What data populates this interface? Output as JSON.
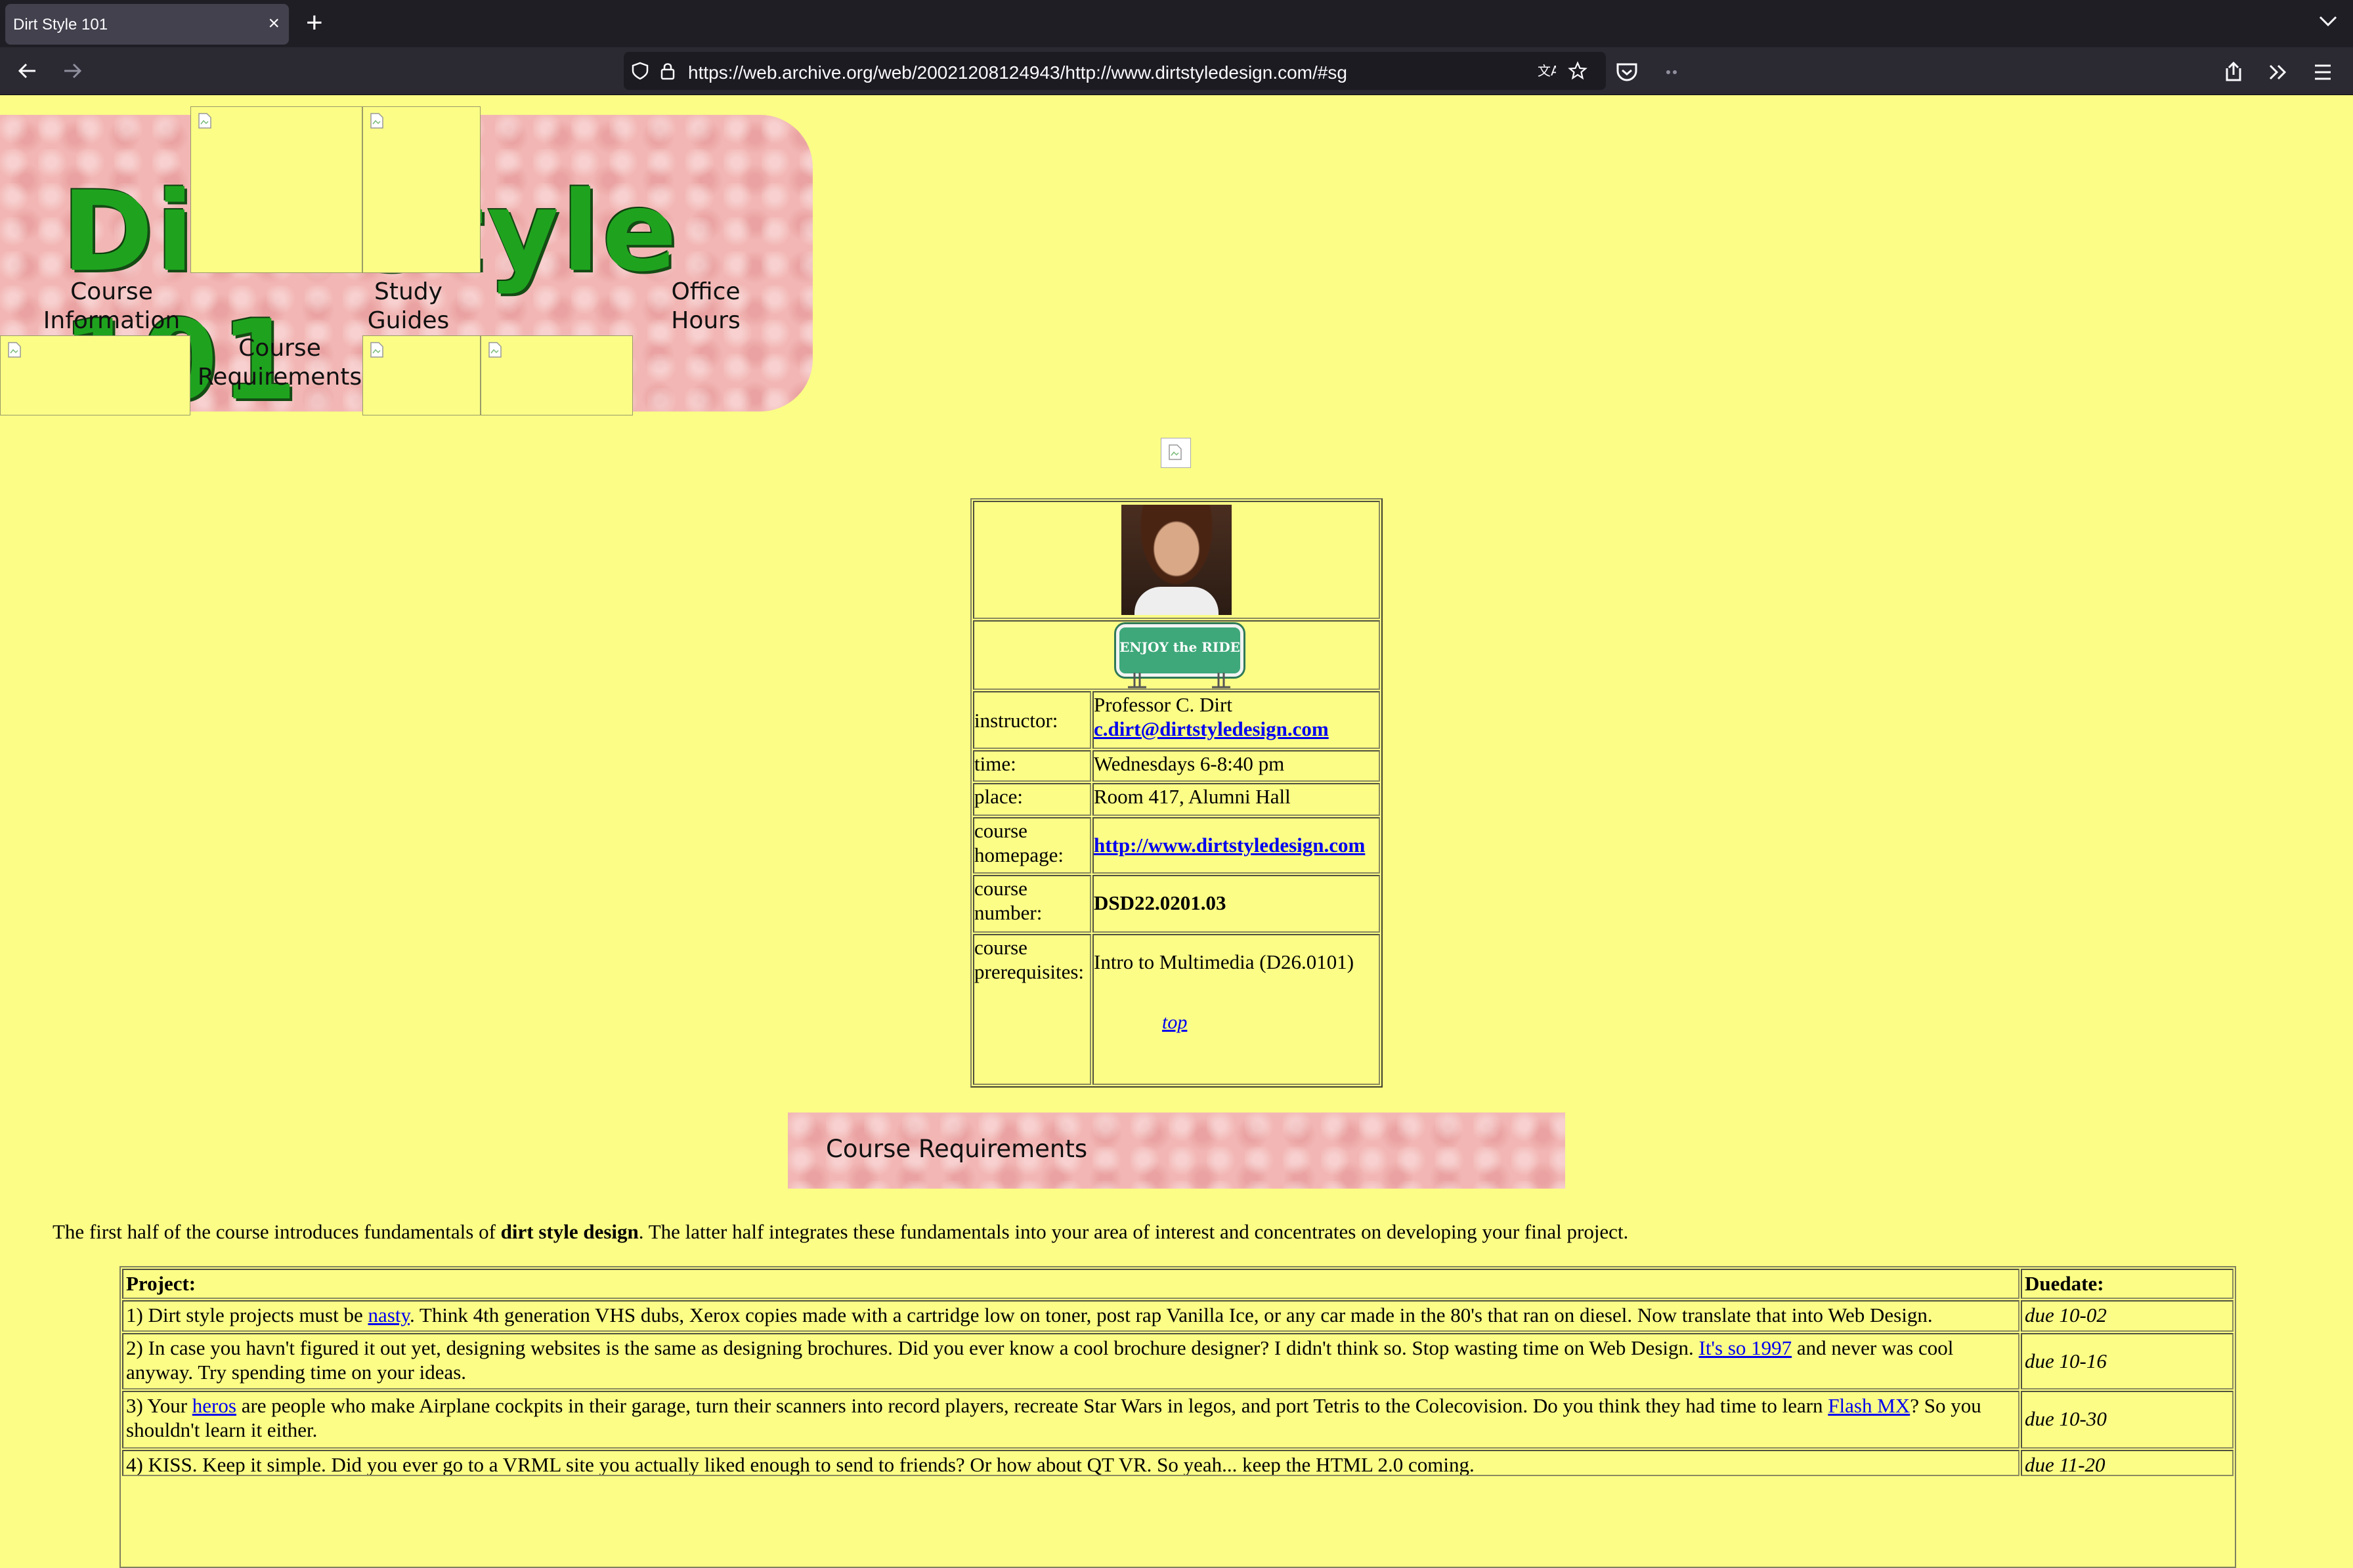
{
  "browser": {
    "tab_title": "Dirt Style 101",
    "tab_close": "×",
    "new_tab": "+",
    "url": "https://web.archive.org/web/20021208124943/http://www.dirtstyledesign.com/#sg"
  },
  "banner": {
    "title": "Dirt Style 101",
    "nav": {
      "course_information": "Course Information",
      "study_guides": "Study Guides",
      "office_hours": "Office Hours",
      "course_requirements": "Course Requirements"
    }
  },
  "info": {
    "sign_text": "ENJOY the RIDE",
    "rows": [
      {
        "label": "instructor:",
        "value": "Professor C. Dirt",
        "link": "c.dirt@dirtstyledesign.com"
      },
      {
        "label": "time:",
        "value": "Wednesdays 6-8:40 pm"
      },
      {
        "label": "place:",
        "value": "Room 417, Alumni Hall"
      },
      {
        "label": "course homepage:",
        "link": "http://www.dirtstyledesign.com"
      },
      {
        "label": "course number:",
        "value": "DSD22.0201.03"
      },
      {
        "label": "course prerequisites:",
        "value": "Intro to Multimedia (D26.0101)"
      }
    ],
    "top_link": "top"
  },
  "requirements": {
    "heading": "Course Requirements",
    "intro_pre": "The first half of the course introduces fundamentals of ",
    "intro_bold": "dirt style design",
    "intro_post": ". The latter half integrates these fundamentals into your area of interest and concentrates on developing your final project.",
    "table": {
      "col_project": "Project:",
      "col_due": "Duedate:",
      "rows": [
        {
          "pre": "1) Dirt style projects must be ",
          "link": "nasty",
          "post": ". Think 4th generation VHS dubs, Xerox copies made with a cartridge low on toner, post rap Vanilla Ice, or any car made in the 80's that ran on diesel. Now translate that into Web Design.",
          "due": "due 10-02"
        },
        {
          "pre": "2) In case you havn't figured it out yet, designing websites is the same as designing brochures. Did you ever know a cool brochure designer? I didn't think so. Stop wasting time on Web Design. ",
          "link": "It's so 1997",
          "post": " and never was cool anyway. Try spending time on your ideas.",
          "due": "due 10-16"
        },
        {
          "pre": "3) Your ",
          "link": "heros",
          "post": " are people who make Airplane cockpits in their garage, turn their scanners into record players, recreate Star Wars in legos, and port Tetris to the Colecovision. Do you think they had time to learn ",
          "link2": "Flash MX",
          "post2": "? So you shouldn't learn it either.",
          "due": "due 10-30"
        },
        {
          "pre": "4) KISS. Keep it simple. Did you ever go to a VRML site you actually liked enough to send to friends? Or how about QT VR. So yeah... keep the HTML 2.0 coming.",
          "due": "due 11-20"
        }
      ]
    }
  }
}
